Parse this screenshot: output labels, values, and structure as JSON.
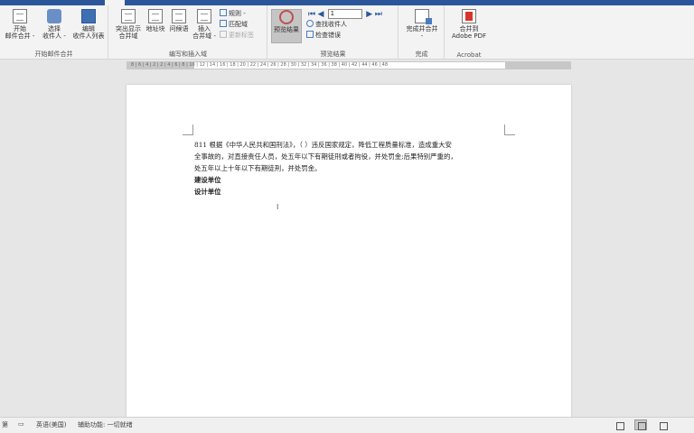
{
  "tabs": [
    "",
    "",
    "",
    "",
    "",
    "",
    "",
    "",
    ""
  ],
  "ribbon": {
    "start_group": {
      "label": "开始邮件合并",
      "start_merge": "开始\n邮件合并 -",
      "select_recipients": "选择\n收件人 -",
      "edit_recipients": "编辑\n收件人列表"
    },
    "write_group": {
      "label": "编写和插入域",
      "highlight_fields": "突出显示\n合并域",
      "address_block": "地址块",
      "greeting_line": "问候语",
      "insert_field": "插入\n合并域 -",
      "rules": "规则 -",
      "match_fields": "匹配域",
      "update_labels": "更新标签"
    },
    "preview_group": {
      "label": "预览结果",
      "preview_results": "预览结果",
      "record_value": "1",
      "find_recipient": "查找收件人",
      "check_errors": "检查错误"
    },
    "finish_group": {
      "label": "完成",
      "finish_merge": "完成并合并\n-"
    },
    "acrobat_group": {
      "label": "Acrobat",
      "merge_pdf": "合并到\nAdobe PDF"
    }
  },
  "ruler": {
    "ticks": "8 | 6 | 4 | 2 | 2 | 4 | 6 | 8 | 10 | 12 | 14 | 16 | 18 | 20 | 22 | 24 | 26 | 28 | 30 | 32 | 34 | 36 | 38 | 40 | 42 | 44 | 46 | 48"
  },
  "document": {
    "line1": "811 根据《中华人民共和国刑法》，（      ）违反国家规定，降低工程质量标准，造成重大安",
    "line2": "全事故的，对直接责任人员，处五年以下有期徒刑或者拘役，并处罚金;后果特别严重的，",
    "line3": "处五年以上十年以下有期徒刑，并处罚金。",
    "line4": "建设单位",
    "line5": "设计单位"
  },
  "statusbar": {
    "page_info": "第",
    "language": "英语(美国)",
    "accessibility": "辅助功能: 一切就绪"
  },
  "colors": {
    "accent": "#2b579a",
    "ribbon_bg": "#f3f3f3",
    "workspace_bg": "#e6e6e6"
  }
}
